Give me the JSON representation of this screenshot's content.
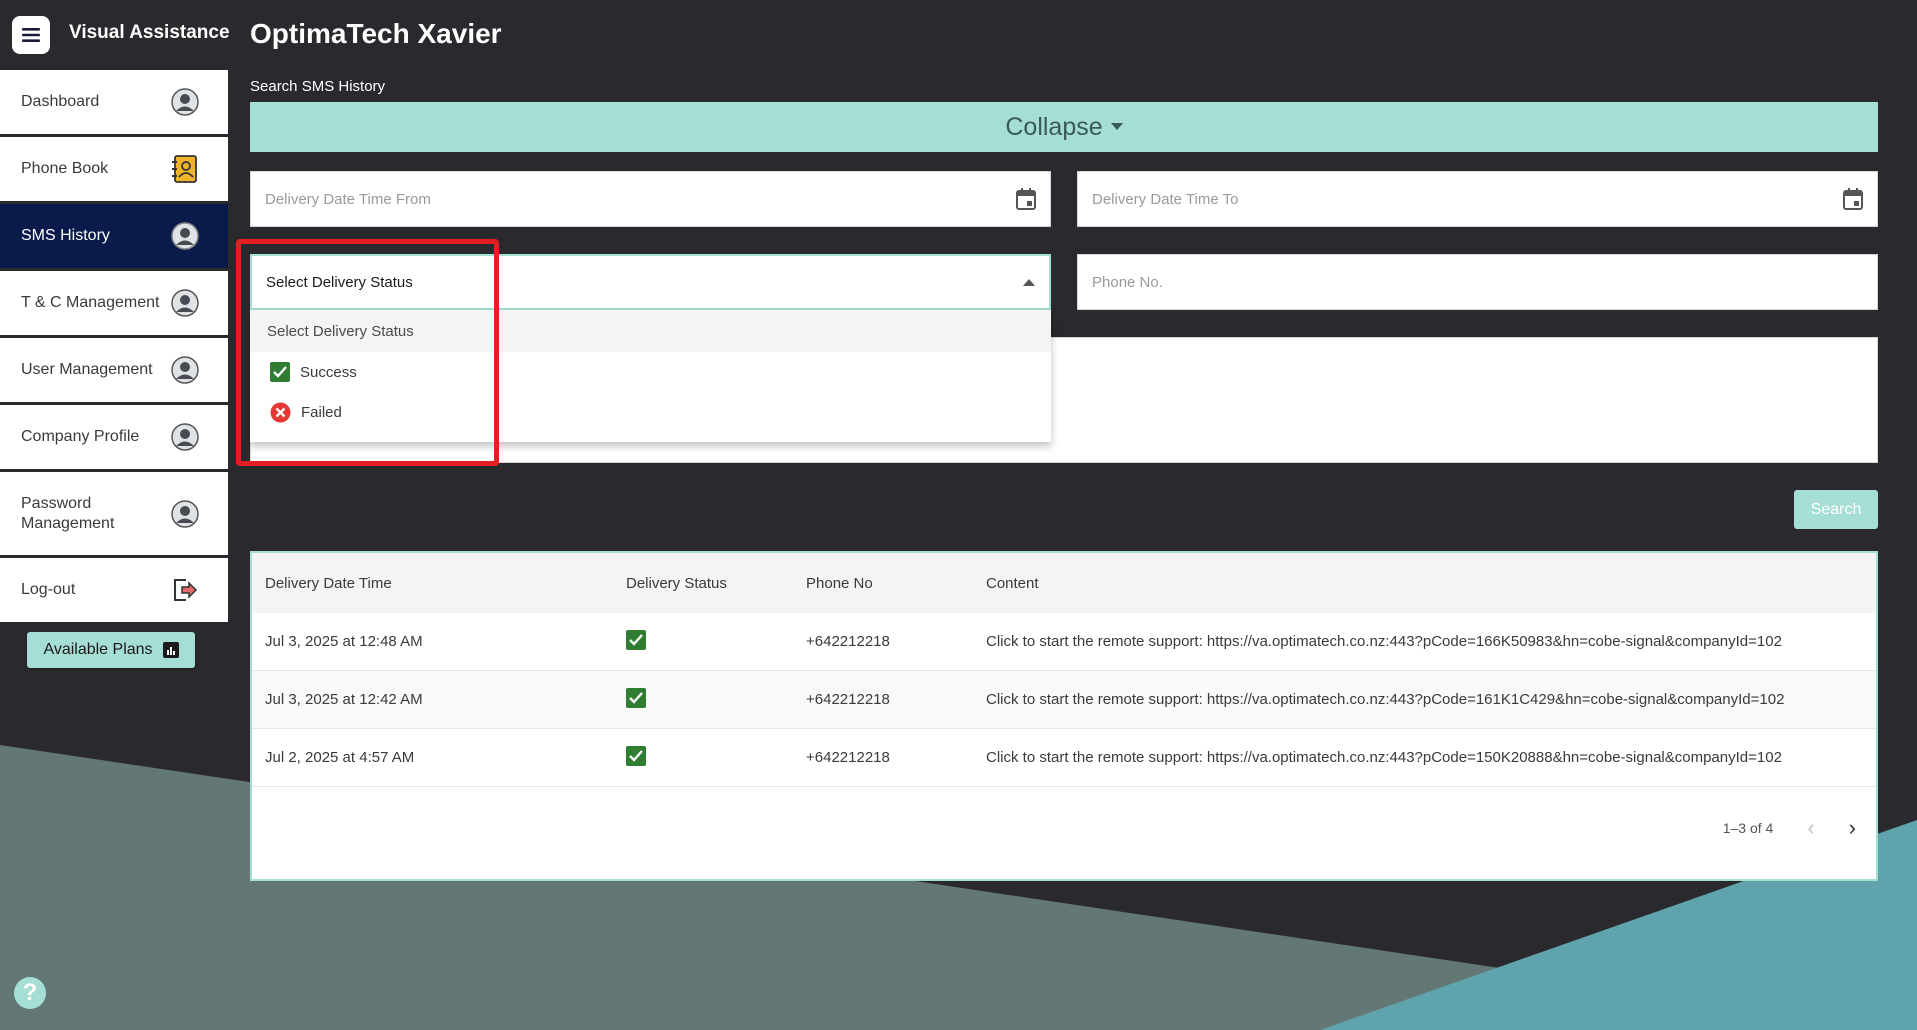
{
  "app": {
    "name": "Visual Assistance",
    "menu_icon": "hamburger-icon"
  },
  "page": {
    "title": "OptimaTech Xavier"
  },
  "sidebar": {
    "items": [
      {
        "label": "Dashboard",
        "icon": "user-avatar-icon",
        "active": false
      },
      {
        "label": "Phone Book",
        "icon": "contact-book-icon",
        "active": false
      },
      {
        "label": "SMS History",
        "icon": "user-avatar-icon",
        "active": true
      },
      {
        "label": "T & C Management",
        "icon": "user-avatar-icon",
        "active": false
      },
      {
        "label": "User Management",
        "icon": "user-avatar-icon",
        "active": false
      },
      {
        "label": "Company Profile",
        "icon": "user-avatar-icon",
        "active": false
      },
      {
        "label": "Password Management",
        "icon": "user-avatar-icon",
        "active": false
      },
      {
        "label": "Log-out",
        "icon": "logout-icon",
        "active": false
      }
    ],
    "plans_button": "Available Plans"
  },
  "search": {
    "section_label": "Search SMS History",
    "collapse_label": "Collapse",
    "date_from_placeholder": "Delivery Date Time From",
    "date_to_placeholder": "Delivery Date Time To",
    "status_value": "Select Delivery Status",
    "phone_placeholder": "Phone No.",
    "search_button": "Search",
    "dropdown": {
      "header": "Select Delivery Status",
      "options": [
        {
          "label": "Success",
          "icon": "checkbox-checked-icon"
        },
        {
          "label": "Failed",
          "icon": "error-circle-icon"
        }
      ]
    }
  },
  "table": {
    "headers": [
      "Delivery Date Time",
      "Delivery Status",
      "Phone No",
      "Content"
    ],
    "rows": [
      {
        "date": "Jul 3, 2025 at 12:48 AM",
        "status": "success",
        "phone": "+642212218",
        "content": "Click to start the remote support: https://va.optimatech.co.nz:443?pCode=166K50983&hn=cobe-signal&companyId=102"
      },
      {
        "date": "Jul 3, 2025 at 12:42 AM",
        "status": "success",
        "phone": "+642212218",
        "content": "Click to start the remote support: https://va.optimatech.co.nz:443?pCode=161K1C429&hn=cobe-signal&companyId=102"
      },
      {
        "date": "Jul 2, 2025 at 4:57 AM",
        "status": "success",
        "phone": "+642212218",
        "content": "Click to start the remote support: https://va.optimatech.co.nz:443?pCode=150K20888&hn=cobe-signal&companyId=102"
      }
    ],
    "pagination": "1–3 of 4"
  },
  "help": {
    "label": "?"
  },
  "colors": {
    "accent": "#a5ded4",
    "active_nav": "#0a1a4a",
    "background": "#2a2a2e",
    "highlight": "#e31e24",
    "success": "#2e7d32",
    "error": "#e53935"
  }
}
